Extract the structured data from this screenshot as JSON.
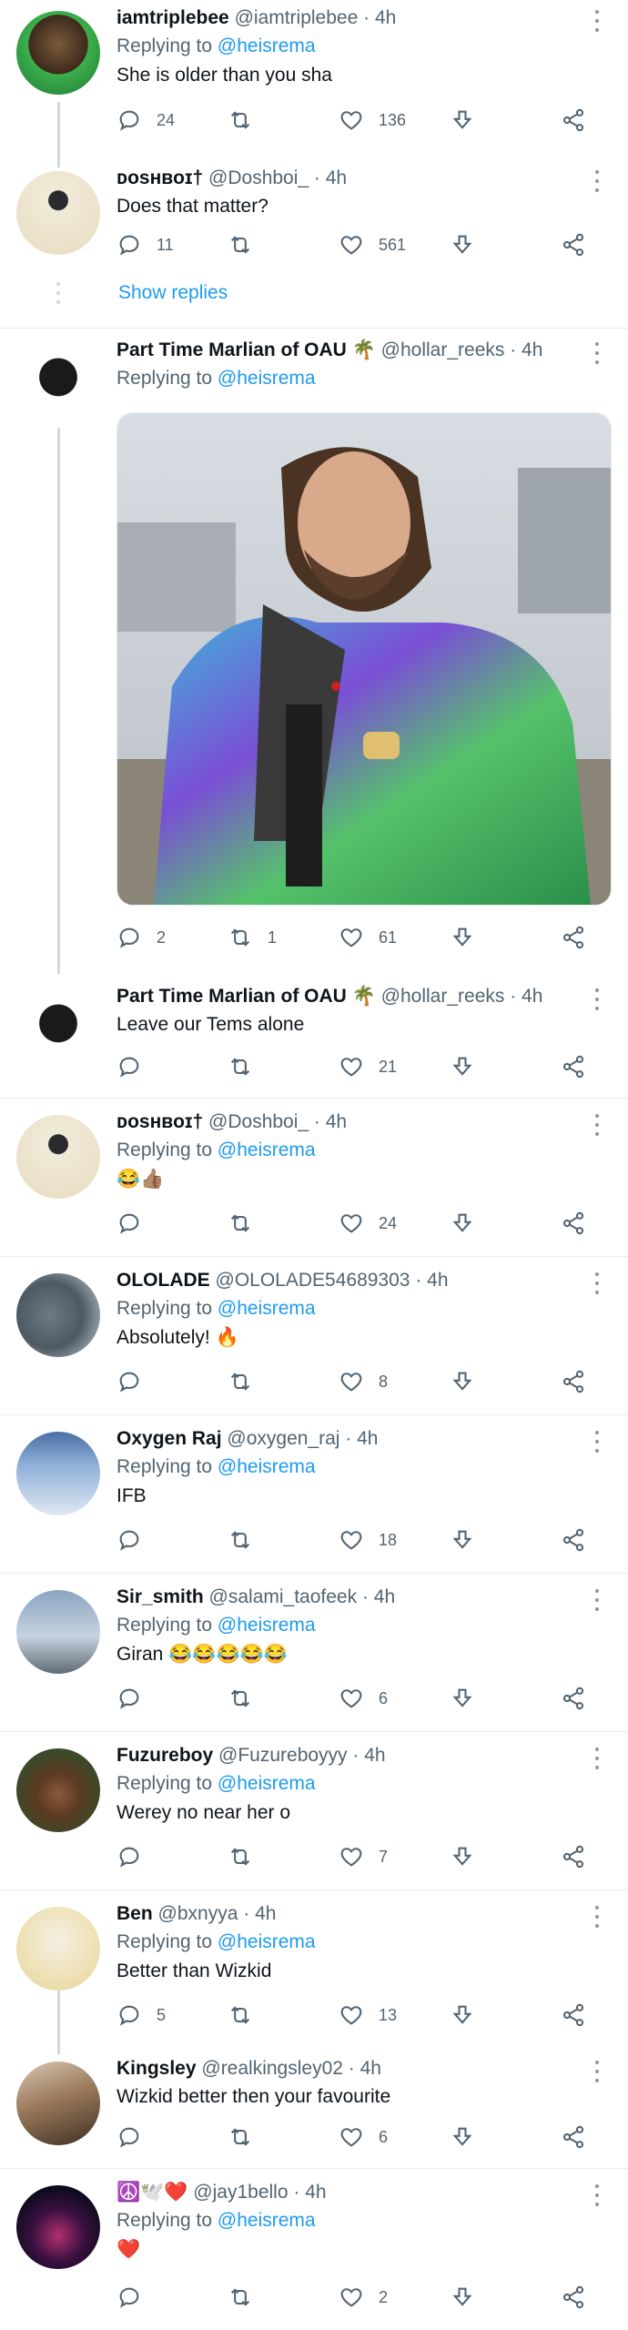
{
  "colors": {
    "accent": "#1d9bf0",
    "muted": "#536471",
    "text": "#0f1419",
    "divider": "#e6ecf0"
  },
  "icons": {
    "reply": "reply-icon",
    "retweet": "retweet-icon",
    "like": "heart-icon",
    "download": "download-icon",
    "share": "share-icon",
    "more": "more-icon"
  },
  "tweets": [
    {
      "name": "iamtriplebee",
      "handle": "@iamtriplebee",
      "time": "4h",
      "reply_prefix": "Replying to",
      "reply_to": "@heisrema",
      "text": "She is older than you sha",
      "replies": "24",
      "retweets": "",
      "likes": "136"
    },
    {
      "name": "ᴅᴏsʜʙᴏɪ†",
      "handle": "@Doshboi_",
      "time": "4h",
      "text": "Does that matter?",
      "replies": "11",
      "retweets": "",
      "likes": "561",
      "show_replies": "Show replies"
    },
    {
      "name": "Part Time Marlian of OAU 🌴",
      "handle": "@hollar_reeks",
      "time": "4h",
      "reply_prefix": "Replying to",
      "reply_to": "@heisrema",
      "text": "",
      "replies": "2",
      "retweets": "1",
      "likes": "61"
    },
    {
      "name": "Part Time Marlian of OAU 🌴",
      "handle": "@hollar_reeks",
      "time": "4h",
      "text": "Leave our Tems alone",
      "replies": "",
      "retweets": "",
      "likes": "21"
    },
    {
      "name": "ᴅᴏsʜʙᴏɪ†",
      "handle": "@Doshboi_",
      "time": "4h",
      "reply_prefix": "Replying to",
      "reply_to": "@heisrema",
      "text": "😂👍🏽",
      "replies": "",
      "retweets": "",
      "likes": "24"
    },
    {
      "name": "OLOLADE",
      "handle": "@OLOLADE54689303",
      "time": "4h",
      "reply_prefix": "Replying to",
      "reply_to": "@heisrema",
      "text": "Absolutely! 🔥",
      "replies": "",
      "retweets": "",
      "likes": "8"
    },
    {
      "name": "Oxygen Raj",
      "handle": "@oxygen_raj",
      "time": "4h",
      "reply_prefix": "Replying to",
      "reply_to": "@heisrema",
      "text": "IFB",
      "replies": "",
      "retweets": "",
      "likes": "18"
    },
    {
      "name": "Sir_smith",
      "handle": "@salami_taofeek",
      "time": "4h",
      "reply_prefix": "Replying to",
      "reply_to": "@heisrema",
      "text": "Giran 😂😂😂😂😂",
      "replies": "",
      "retweets": "",
      "likes": "6"
    },
    {
      "name": "Fuzureboy",
      "handle": "@Fuzureboyyy",
      "time": "4h",
      "reply_prefix": "Replying to",
      "reply_to": "@heisrema",
      "text": "Werey no near her o",
      "replies": "",
      "retweets": "",
      "likes": "7"
    },
    {
      "name": "Ben",
      "handle": "@bxnyya",
      "time": "4h",
      "reply_prefix": "Replying to",
      "reply_to": "@heisrema",
      "text": "Better than Wizkid",
      "replies": "5",
      "retweets": "",
      "likes": "13"
    },
    {
      "name": "Kingsley",
      "handle": "@realkingsley02",
      "time": "4h",
      "text": "Wizkid better then your favourite",
      "replies": "",
      "retweets": "",
      "likes": "6"
    },
    {
      "name": "☮️🕊️❤️",
      "handle": "@jay1bello",
      "time": "4h",
      "reply_prefix": "Replying to",
      "reply_to": "@heisrema",
      "text": "❤️",
      "replies": "",
      "retweets": "",
      "likes": "2"
    }
  ]
}
